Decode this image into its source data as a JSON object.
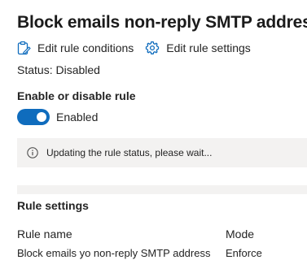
{
  "title": "Block emails non-reply SMTP address",
  "actions": {
    "edit_conditions": {
      "label": "Edit rule conditions",
      "icon": "clipboard-edit-icon"
    },
    "edit_settings": {
      "label": "Edit rule settings",
      "icon": "gear-icon"
    }
  },
  "status": "Status: Disabled",
  "toggle": {
    "heading": "Enable or disable rule",
    "state": "on",
    "label": "Enabled",
    "color": "#0f6cbd"
  },
  "info": {
    "icon": "info-icon",
    "message": "Updating the rule status, please wait..."
  },
  "settings": {
    "title": "Rule settings",
    "columns": [
      "Rule name",
      "Mode"
    ],
    "rows": [
      [
        "Block emails yo non-reply SMTP address",
        "Enforce"
      ]
    ]
  }
}
